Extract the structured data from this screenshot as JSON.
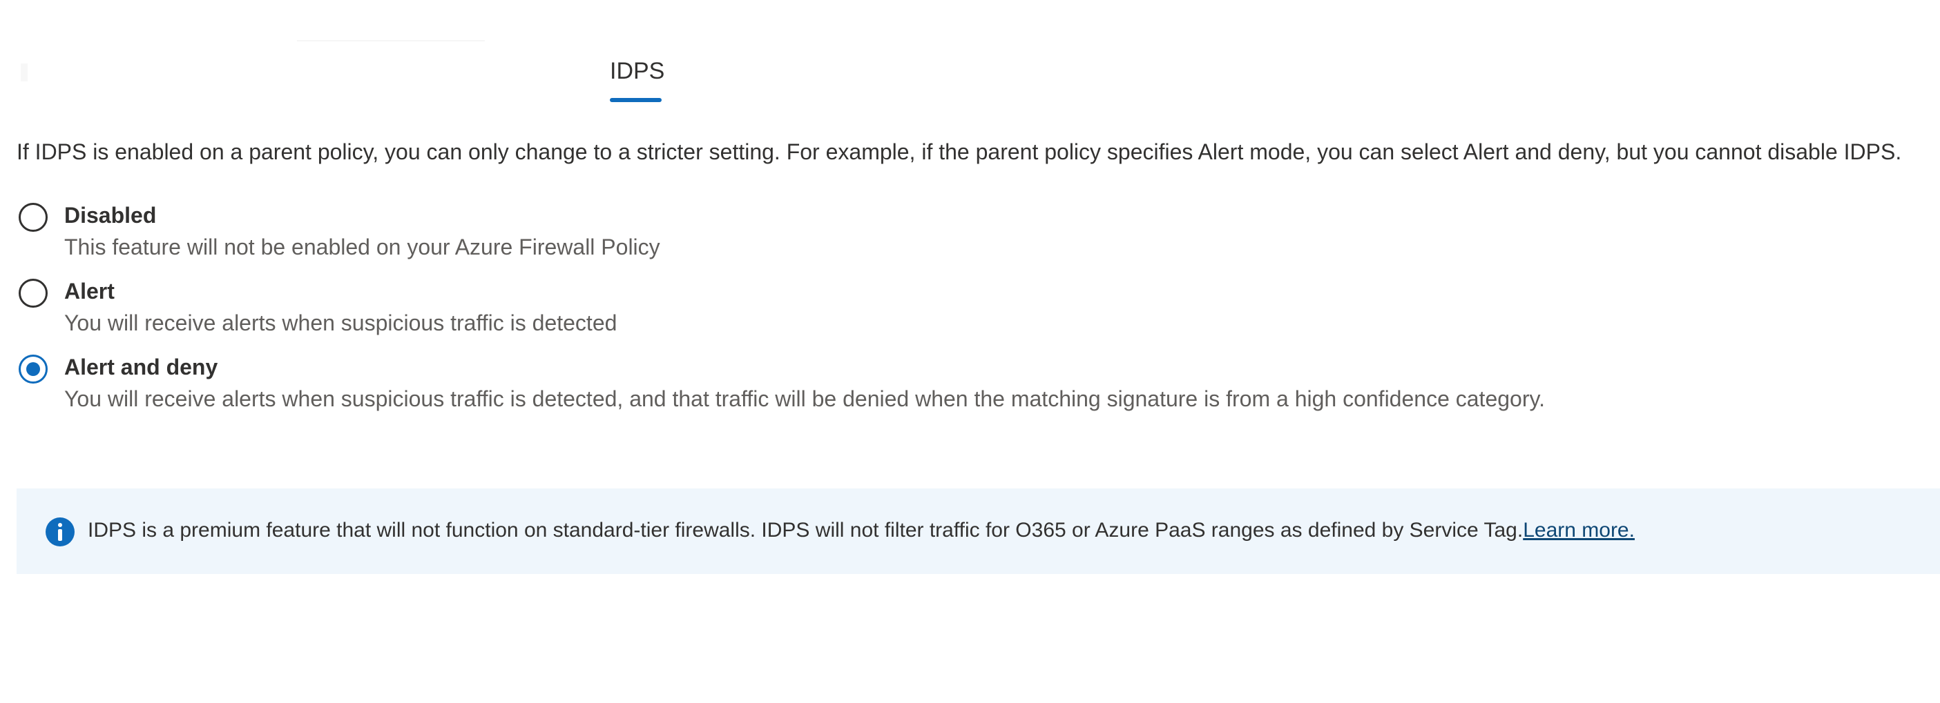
{
  "tabs": [
    {
      "label": "IDPS",
      "selected": true
    }
  ],
  "intro_text": "If IDPS is enabled on a parent policy, you can only change to a stricter setting. For example, if the parent policy specifies Alert mode, you can select Alert and deny, but you cannot disable IDPS.",
  "mode_options": [
    {
      "label": "Disabled",
      "description": "This feature will not be enabled on your Azure Firewall Policy",
      "selected": false
    },
    {
      "label": "Alert",
      "description": "You will receive alerts when suspicious traffic is detected",
      "selected": false
    },
    {
      "label": "Alert and deny",
      "description": "You will receive alerts when suspicious traffic is detected, and that traffic will be denied when the matching signature is from a high confidence category.",
      "selected": true
    }
  ],
  "info_bar": {
    "icon": "info-icon",
    "message": "IDPS is a premium feature that will not function on standard-tier firewalls. IDPS will not filter traffic for O365 or Azure PaaS ranges as defined by Service Tag.",
    "link_label": "Learn more."
  },
  "colors": {
    "accent": "#0f6cbd",
    "text": "#323130",
    "secondary_text": "#605e5c",
    "info_background": "#eff6fc",
    "link": "#0e4775"
  }
}
